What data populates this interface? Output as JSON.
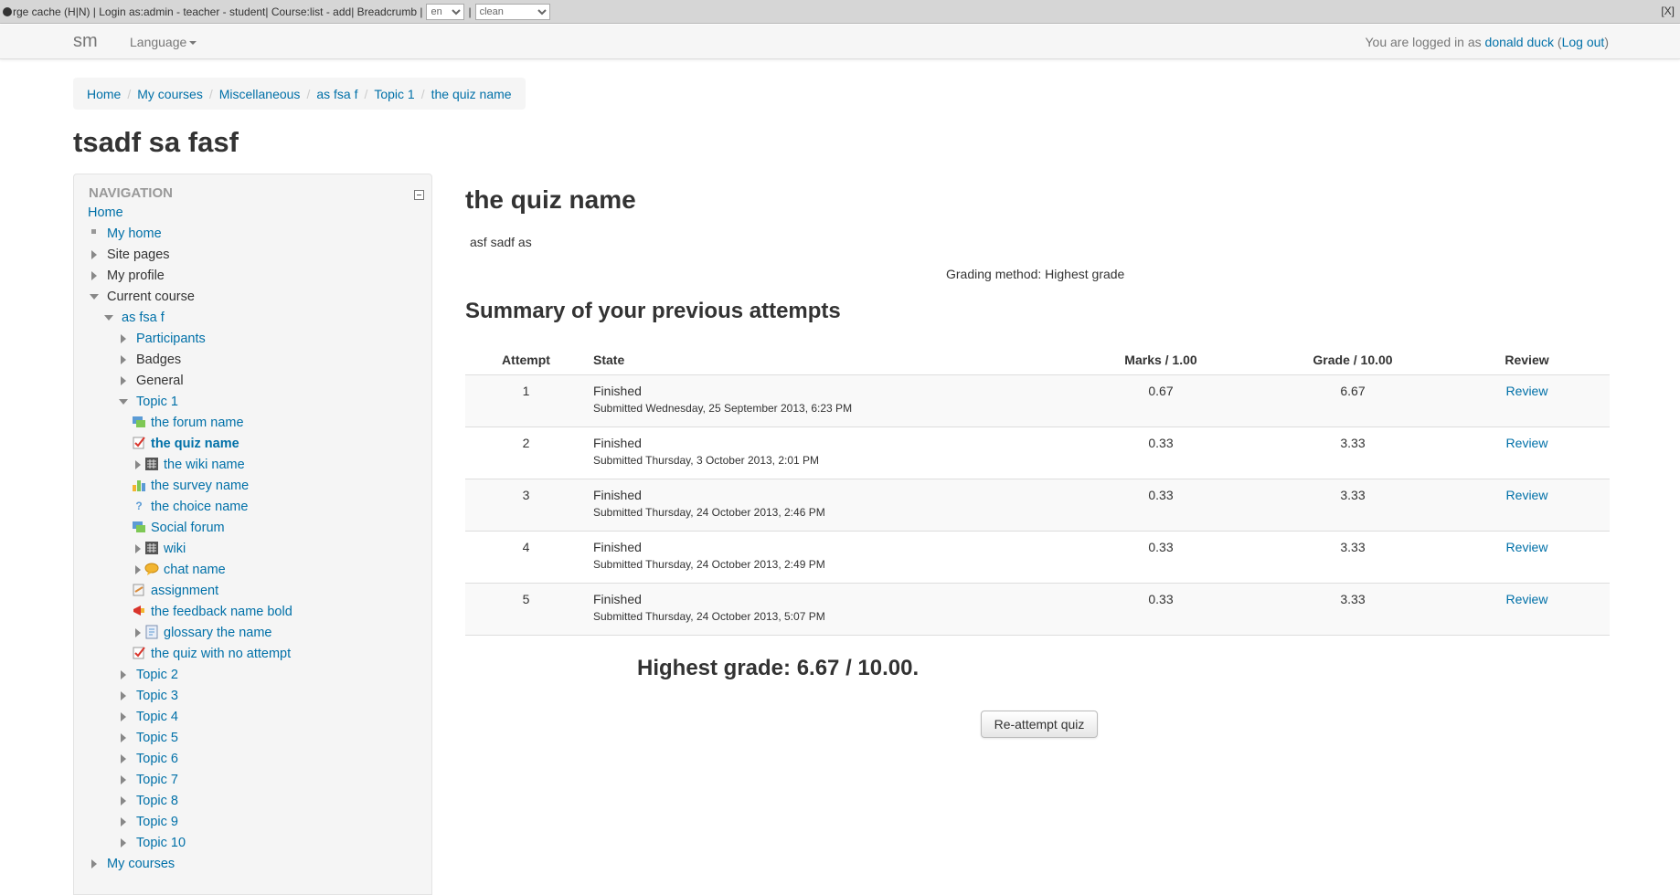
{
  "devbar": {
    "text": "rge cache (H|N) | Login as: ",
    "login_as": "admin - teacher - student",
    "course_sep": " | Course: ",
    "course": "list - add",
    "breadcrumb_sep": " | Breadcrumb | ",
    "lang_value": "en",
    "theme_value": "clean",
    "close": "[X]"
  },
  "navbar": {
    "brand": "sm",
    "language": "Language",
    "logged_prefix": "You are logged in as ",
    "user": "donald duck",
    "logout": "Log out"
  },
  "breadcrumb": [
    "Home",
    "My courses",
    "Miscellaneous",
    "as fsa f",
    "Topic 1",
    "the quiz name"
  ],
  "course_title": "tsadf sa fasf",
  "navigation": {
    "header": "NAVIGATION",
    "home": "Home",
    "my_home": "My home",
    "site_pages": "Site pages",
    "my_profile": "My profile",
    "current_course": "Current course",
    "course": "as fsa f",
    "participants": "Participants",
    "badges": "Badges",
    "general": "General",
    "topic1": "Topic 1",
    "forum": "the forum name",
    "quiz": "the quiz name",
    "wiki": "the wiki name",
    "survey": "the survey name",
    "choice": "the choice name",
    "social_forum": "Social forum",
    "wiki2": "wiki",
    "chat": "chat name",
    "assignment": "assignment",
    "feedback": "the feedback name bold",
    "glossary": "glossary the name",
    "quiz_no_attempt": "the quiz with no attempt",
    "topics": [
      "Topic 2",
      "Topic 3",
      "Topic 4",
      "Topic 5",
      "Topic 6",
      "Topic 7",
      "Topic 8",
      "Topic 9",
      "Topic 10"
    ],
    "my_courses": "My courses"
  },
  "main": {
    "quiz_title": "the quiz name",
    "intro": "asf sadf as",
    "grading_method": "Grading method: Highest grade",
    "summary_title": "Summary of your previous attempts",
    "columns": {
      "attempt": "Attempt",
      "state": "State",
      "marks": "Marks / 1.00",
      "grade": "Grade / 10.00",
      "review": "Review"
    },
    "attempts": [
      {
        "attempt": "1",
        "state": "Finished",
        "submitted": "Submitted Wednesday, 25 September 2013, 6:23 PM",
        "marks": "0.67",
        "grade": "6.67",
        "review": "Review"
      },
      {
        "attempt": "2",
        "state": "Finished",
        "submitted": "Submitted Thursday, 3 October 2013, 2:01 PM",
        "marks": "0.33",
        "grade": "3.33",
        "review": "Review"
      },
      {
        "attempt": "3",
        "state": "Finished",
        "submitted": "Submitted Thursday, 24 October 2013, 2:46 PM",
        "marks": "0.33",
        "grade": "3.33",
        "review": "Review"
      },
      {
        "attempt": "4",
        "state": "Finished",
        "submitted": "Submitted Thursday, 24 October 2013, 2:49 PM",
        "marks": "0.33",
        "grade": "3.33",
        "review": "Review"
      },
      {
        "attempt": "5",
        "state": "Finished",
        "submitted": "Submitted Thursday, 24 October 2013, 5:07 PM",
        "marks": "0.33",
        "grade": "3.33",
        "review": "Review"
      }
    ],
    "highest_grade": "Highest grade: 6.67 / 10.00.",
    "reattempt_button": "Re-attempt quiz"
  },
  "colors": {
    "link": "#0070a8",
    "text": "#333333",
    "block_bg": "#f5f5f5"
  }
}
